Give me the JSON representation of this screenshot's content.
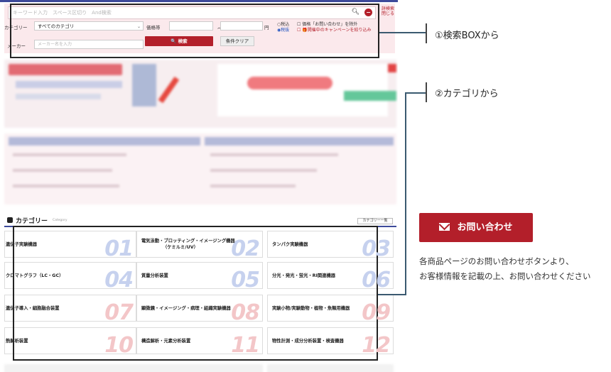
{
  "search": {
    "keyword_placeholder": "キーワード入力　スペース区切り　And検索",
    "close_label_line1": "詳検索",
    "close_label_line2": "閉じる",
    "category_label": "カテゴリー",
    "category_value": "すべてのカテゴリ",
    "price_label": "価格帯",
    "price_from": "",
    "price_tilde": "〜",
    "price_to": "",
    "yen": "円",
    "tax_in": "○税込",
    "tax_out": "◉税抜",
    "exclude_inquiry": "☐ 価格「お問い合わせ」を除外",
    "campaign": "☐ 🎁開催中のキャンペーンを絞り込み",
    "maker_label": "メーカー",
    "maker_placeholder": "メーカー名を入力",
    "search_button": "🔍 検索",
    "clear_button": "条件クリア"
  },
  "categories": {
    "heading": "カテゴリー",
    "heading_sub": "Category",
    "list_button": "カテゴリー一覧",
    "items": [
      {
        "label": "遺伝子実験機器",
        "num": "01"
      },
      {
        "label": "電気泳動・ブロッティング・イメージング機器",
        "label2": "（ケミルミ/UV）",
        "num": "02"
      },
      {
        "label": "タンパク実験機器",
        "num": "03"
      },
      {
        "label": "クロマトグラフ（LC・GC）",
        "num": "04"
      },
      {
        "label": "質量分析装置",
        "num": "05"
      },
      {
        "label": "分光・発光・蛍光・RI関連機器",
        "num": "06"
      },
      {
        "label": "遺伝子導入・細胞融合装置",
        "num": "07"
      },
      {
        "label": "顕微鏡・イメージング・病理・組織実験機器",
        "num": "08"
      },
      {
        "label": "実験小物/実験動物・植物・魚類用機器",
        "num": "09"
      },
      {
        "label": "熱解析装置",
        "num": "10"
      },
      {
        "label": "構造解析・元素分析装置",
        "num": "11"
      },
      {
        "label": "物性計測・成分分析装置・検査機器",
        "num": "12"
      }
    ]
  },
  "annotations": {
    "search_box": "①検索BOXから",
    "category": "②カテゴリから"
  },
  "contact": {
    "button": "お問い合わせ",
    "desc_line1": "各商品ページのお問い合わせボタンより、",
    "desc_line2": "お客様情報を記載の上、お問い合わせください"
  }
}
